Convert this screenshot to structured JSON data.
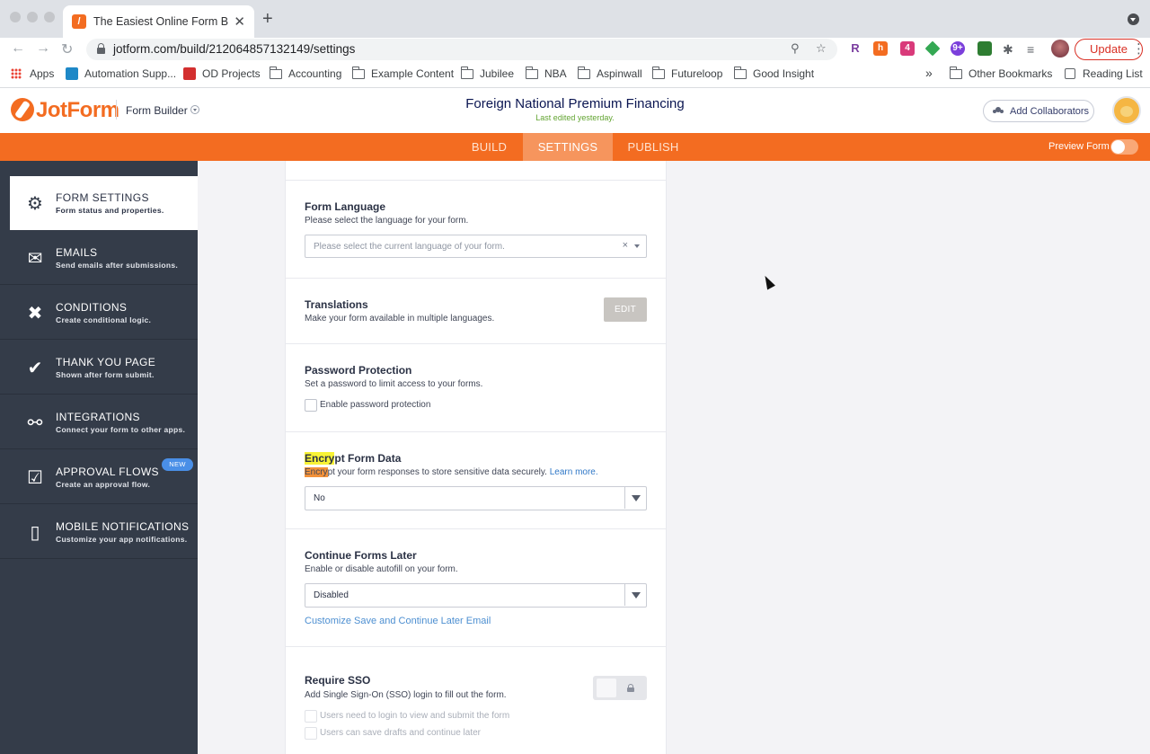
{
  "browser": {
    "tab_title": "The Easiest Online Form Builder",
    "tab_favicon": "jotform-favicon",
    "new_tab": "+",
    "url": "jotform.com/build/212064857132149/settings",
    "update_label": "Update",
    "bookmarks": [
      "Apps",
      "Automation Supp...",
      "OD Projects",
      "Accounting",
      "Example Content",
      "Jubilee",
      "NBA",
      "Aspinwall",
      "Futureloop",
      "Good Insight"
    ],
    "overflow": "»",
    "other_bookmarks": "Other Bookmarks",
    "reading_list": "Reading List",
    "extensions": [
      {
        "label": "R",
        "color": "#ffffff",
        "text": "#7b3fa0"
      },
      {
        "label": "h",
        "color": "#f36c21",
        "text": "#ffffff"
      },
      {
        "label": "4",
        "color": "#d93a7a",
        "text": "#ffffff"
      },
      {
        "label": "",
        "color": "#34a853",
        "text": "#ffffff"
      },
      {
        "label": "9+",
        "color": "#7b3fdb",
        "text": "#ffffff"
      },
      {
        "label": "",
        "color": "#2e7d32",
        "text": "#ffffff"
      }
    ]
  },
  "header": {
    "logo_text": "JotForm",
    "form_builder_label": "Form Builder",
    "form_title": "Foreign National Premium Financing",
    "last_edited": "Last edited yesterday.",
    "add_collaborators": "Add Collaborators"
  },
  "nav": {
    "tabs": [
      {
        "label": "BUILD",
        "active": false
      },
      {
        "label": "SETTINGS",
        "active": true
      },
      {
        "label": "PUBLISH",
        "active": false
      }
    ],
    "preview_label": "Preview Form",
    "accent": "#f36c21"
  },
  "sidebar": {
    "items": [
      {
        "title": "FORM SETTINGS",
        "subtitle": "Form status and properties.",
        "icon": "gear-icon",
        "active": true
      },
      {
        "title": "EMAILS",
        "subtitle": "Send emails after submissions.",
        "icon": "envelope-icon",
        "active": false
      },
      {
        "title": "CONDITIONS",
        "subtitle": "Create conditional logic.",
        "icon": "tools-icon",
        "active": false
      },
      {
        "title": "THANK YOU PAGE",
        "subtitle": "Shown after form submit.",
        "icon": "check-circle-icon",
        "active": false
      },
      {
        "title": "INTEGRATIONS",
        "subtitle": "Connect your form to other apps.",
        "icon": "link-icon",
        "active": false
      },
      {
        "title": "APPROVAL FLOWS",
        "subtitle": "Create an approval flow.",
        "icon": "approval-icon",
        "active": false,
        "badge": "NEW"
      },
      {
        "title": "MOBILE NOTIFICATIONS",
        "subtitle": "Customize your app notifications.",
        "icon": "mobile-notification-icon",
        "active": false
      }
    ]
  },
  "settings": {
    "language": {
      "title": "Form Language",
      "desc": "Please select the language for your form.",
      "placeholder": "Please select the current language of your form.",
      "clear": "×"
    },
    "translations": {
      "title": "Translations",
      "desc": "Make your form available in multiple languages.",
      "edit_label": "EDIT"
    },
    "password": {
      "title": "Password Protection",
      "desc": "Set a password to limit access to your forms.",
      "checkbox_label": "Enable password protection"
    },
    "encrypt": {
      "title_highlight": "Encry",
      "title_rest": "pt Form Data",
      "desc_highlight": "Encry",
      "desc_rest": "pt your form responses to store sensitive data securely. ",
      "learn_more": "Learn more.",
      "value": "No"
    },
    "continue_later": {
      "title": "Continue Forms Later",
      "desc": "Enable or disable autofill on your form.",
      "value": "Disabled",
      "customize_link": "Customize Save and Continue Later Email"
    },
    "sso": {
      "title": "Require SSO",
      "desc": "Add Single Sign-On (SSO) login to fill out the form.",
      "option_1": "Users need to login to view and submit the form",
      "option_2": "Users can save drafts and continue later"
    }
  }
}
